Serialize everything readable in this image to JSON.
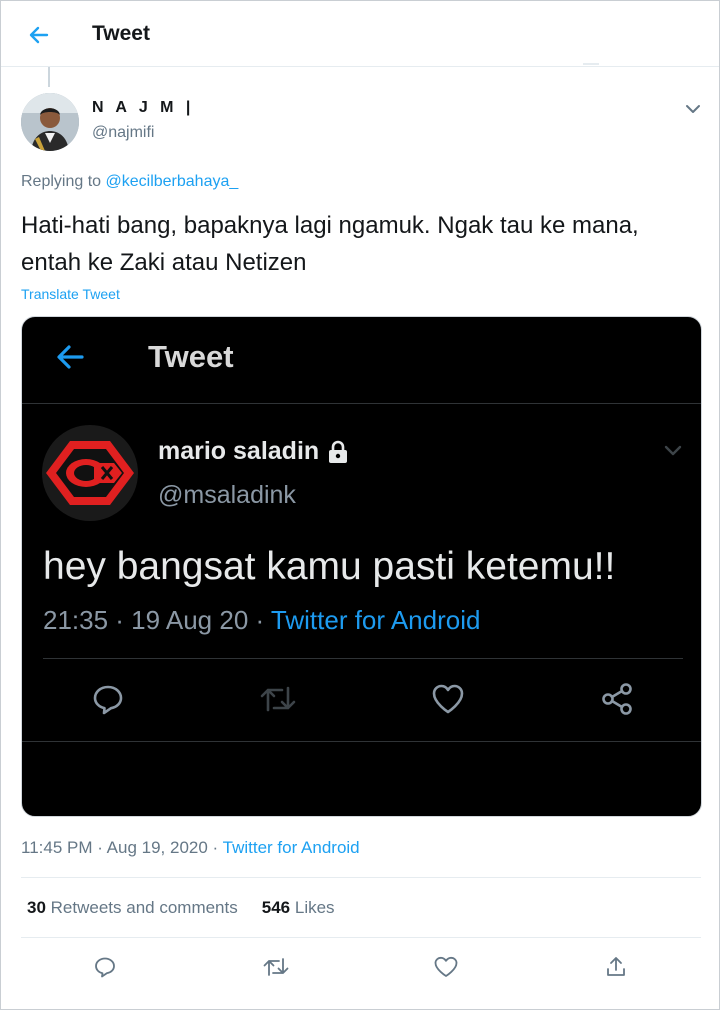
{
  "header": {
    "title": "Tweet"
  },
  "author": {
    "name": "N A J M |",
    "handle": "@najmifi"
  },
  "reply": {
    "prefix": "Replying to",
    "to": "@kecilberbahaya_"
  },
  "tweet": {
    "text": "Hati-hati bang, bapaknya lagi ngamuk. Ngak tau ke mana, entah ke Zaki atau Netizen",
    "translate_label": "Translate Tweet",
    "timestamp": "11:45 PM · Aug 19, 2020 · ",
    "source": "Twitter for Android"
  },
  "embedded": {
    "title": "Tweet",
    "name": "mario saladin",
    "handle": "@msaladink",
    "text": "hey bangsat kamu pasti ketemu!!",
    "meta": "21:35 · 19 Aug 20 · ",
    "source": "Twitter for Android"
  },
  "stats": {
    "retweets_count": "30",
    "retweets_label": "Retweets and comments",
    "likes_count": "546",
    "likes_label": "Likes"
  },
  "colors": {
    "accent": "#1da1f2",
    "secondary_text": "#657786",
    "dark_bg": "#000000"
  },
  "icons": {
    "back": "arrow-left-icon",
    "caret": "chevron-down-icon",
    "reply": "comment-icon",
    "retweet": "retweet-icon",
    "like": "heart-icon",
    "share": "share-icon",
    "lock": "lock-icon"
  }
}
